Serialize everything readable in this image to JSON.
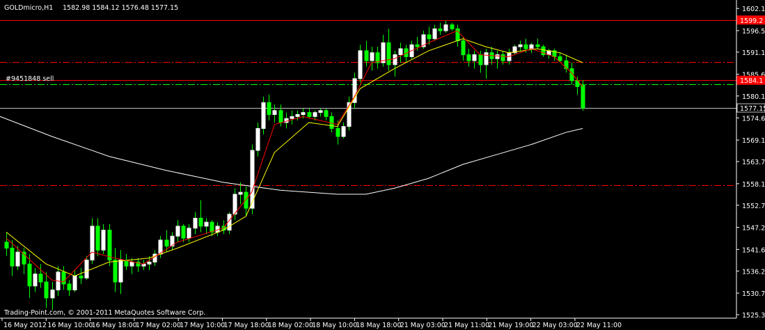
{
  "header": {
    "symbol": "GOLDmicro,H1",
    "ohlc": "1582.98 1584.12 1576.48 1577.15"
  },
  "footer": {
    "copyright": "Trading-Point.com, © 2001-2011 MetaQuotes Software Corp."
  },
  "order": {
    "label": "#9451848 sell"
  },
  "colors": {
    "background": "#000000",
    "bull_candle": "#ffffff",
    "bear_candle": "#00ff00",
    "ma_fast": "#ff0000",
    "ma_mid": "#ffff00",
    "ma_slow": "#ffffff",
    "hline_red": "#ff0000",
    "hline_green": "#00ff00",
    "price_line": "#c0c0c0",
    "tag_red": "#ff0000"
  },
  "chart_data": {
    "type": "candlestick",
    "symbol": "GOLDmicro",
    "timeframe": "H1",
    "ylim": [
      1525.3,
      1603.0
    ],
    "y_ticks": [
      "1602.10",
      "1596.55",
      "1591.15",
      "1585.60",
      "1580.15",
      "1574.65",
      "1569.10",
      "1563.70",
      "1558.15",
      "1552.75",
      "1547.20",
      "1541.65",
      "1536.25",
      "1530.70",
      "1525.30"
    ],
    "x_ticks": [
      "16 May 2012",
      "16 May 10:00",
      "16 May 18:00",
      "17 May 02:00",
      "17 May 10:00",
      "17 May 18:00",
      "18 May 02:00",
      "18 May 10:00",
      "18 May 18:00",
      "21 May 03:00",
      "21 May 11:00",
      "21 May 19:00",
      "22 May 03:00",
      "22 May 11:00"
    ],
    "price_tags": [
      {
        "price": 1599.2,
        "label": "1599.2",
        "color": "#ff0000"
      },
      {
        "price": 1584.1,
        "label": "1584.1",
        "color": "#ff0000"
      },
      {
        "price": 1577.15,
        "label": "1577.15",
        "color": "#ffffff"
      }
    ],
    "hlines": [
      {
        "price": 1599.2,
        "style": "solid",
        "color": "#ff0000"
      },
      {
        "price": 1588.6,
        "style": "dashdot",
        "color": "#ff0000"
      },
      {
        "price": 1584.1,
        "style": "solid",
        "color": "#ff0000"
      },
      {
        "price": 1583.1,
        "style": "dashdot",
        "color": "#00ff00"
      },
      {
        "price": 1577.15,
        "style": "solid",
        "color": "#c0c0c0"
      },
      {
        "price": 1557.8,
        "style": "dashdot",
        "color": "#ff0000"
      }
    ],
    "candles": [
      [
        1543.5,
        1546.0,
        1540.0,
        1542.0
      ],
      [
        1542.0,
        1544.0,
        1535.0,
        1537.5
      ],
      [
        1537.5,
        1542.5,
        1536.5,
        1541.0
      ],
      [
        1541.0,
        1542.0,
        1535.5,
        1538.0
      ],
      [
        1538.0,
        1540.5,
        1529.5,
        1532.5
      ],
      [
        1532.5,
        1537.0,
        1531.0,
        1535.5
      ],
      [
        1535.5,
        1538.0,
        1532.0,
        1533.5
      ],
      [
        1533.5,
        1536.0,
        1527.0,
        1529.5
      ],
      [
        1529.5,
        1533.5,
        1526.5,
        1531.5
      ],
      [
        1531.5,
        1537.5,
        1530.0,
        1536.0
      ],
      [
        1536.0,
        1537.5,
        1531.5,
        1533.0
      ],
      [
        1533.0,
        1534.0,
        1530.0,
        1531.5
      ],
      [
        1531.5,
        1536.5,
        1531.0,
        1535.0
      ],
      [
        1535.0,
        1537.0,
        1533.0,
        1534.5
      ],
      [
        1534.5,
        1540.0,
        1534.0,
        1539.0
      ],
      [
        1539.0,
        1549.5,
        1538.0,
        1547.5
      ],
      [
        1547.5,
        1549.5,
        1540.0,
        1541.5
      ],
      [
        1541.5,
        1548.0,
        1540.5,
        1546.5
      ],
      [
        1546.5,
        1548.0,
        1537.5,
        1539.0
      ],
      [
        1539.0,
        1542.0,
        1531.0,
        1533.5
      ],
      [
        1533.5,
        1541.5,
        1530.5,
        1539.0
      ],
      [
        1539.0,
        1540.5,
        1536.5,
        1537.5
      ],
      [
        1537.5,
        1539.5,
        1535.5,
        1538.5
      ],
      [
        1538.5,
        1539.5,
        1536.0,
        1537.5
      ],
      [
        1537.5,
        1539.0,
        1536.5,
        1538.0
      ],
      [
        1538.0,
        1540.0,
        1536.5,
        1538.5
      ],
      [
        1538.5,
        1541.5,
        1537.5,
        1540.5
      ],
      [
        1540.5,
        1545.0,
        1539.5,
        1544.0
      ],
      [
        1544.0,
        1546.5,
        1541.0,
        1542.5
      ],
      [
        1542.5,
        1546.0,
        1541.5,
        1545.0
      ],
      [
        1545.0,
        1549.0,
        1543.5,
        1547.5
      ],
      [
        1547.5,
        1548.0,
        1543.5,
        1544.5
      ],
      [
        1544.5,
        1548.0,
        1543.5,
        1547.0
      ],
      [
        1547.0,
        1551.0,
        1545.5,
        1549.5
      ],
      [
        1549.5,
        1554.0,
        1546.0,
        1547.5
      ],
      [
        1547.5,
        1549.5,
        1545.5,
        1548.5
      ],
      [
        1548.5,
        1549.0,
        1545.0,
        1546.0
      ],
      [
        1546.0,
        1548.5,
        1545.0,
        1547.5
      ],
      [
        1547.5,
        1549.0,
        1545.5,
        1546.5
      ],
      [
        1546.5,
        1551.0,
        1545.5,
        1550.5
      ],
      [
        1550.5,
        1557.0,
        1549.0,
        1555.5
      ],
      [
        1555.5,
        1558.5,
        1553.0,
        1556.0
      ],
      [
        1556.0,
        1557.5,
        1550.0,
        1552.0
      ],
      [
        1552.0,
        1568.0,
        1550.5,
        1566.5
      ],
      [
        1566.5,
        1573.5,
        1565.0,
        1572.0
      ],
      [
        1572.0,
        1580.0,
        1570.5,
        1578.5
      ],
      [
        1578.5,
        1580.5,
        1574.0,
        1575.5
      ],
      [
        1575.5,
        1578.0,
        1573.5,
        1576.5
      ],
      [
        1576.5,
        1578.0,
        1572.5,
        1573.5
      ],
      [
        1573.5,
        1576.0,
        1572.0,
        1574.5
      ],
      [
        1574.5,
        1576.5,
        1573.0,
        1575.0
      ],
      [
        1575.0,
        1576.5,
        1574.0,
        1575.5
      ],
      [
        1575.5,
        1577.0,
        1574.5,
        1576.0
      ],
      [
        1576.0,
        1577.0,
        1574.5,
        1575.0
      ],
      [
        1575.0,
        1576.5,
        1574.0,
        1576.0
      ],
      [
        1576.0,
        1577.0,
        1575.0,
        1576.5
      ],
      [
        1576.5,
        1577.0,
        1574.0,
        1575.0
      ],
      [
        1575.0,
        1576.0,
        1571.0,
        1572.0
      ],
      [
        1572.0,
        1574.0,
        1568.0,
        1570.0
      ],
      [
        1570.0,
        1573.5,
        1569.5,
        1572.5
      ],
      [
        1572.5,
        1580.0,
        1571.5,
        1578.5
      ],
      [
        1578.5,
        1586.0,
        1577.0,
        1584.5
      ],
      [
        1584.5,
        1593.0,
        1583.5,
        1591.5
      ],
      [
        1591.5,
        1594.0,
        1587.5,
        1589.0
      ],
      [
        1589.0,
        1592.5,
        1586.5,
        1591.0
      ],
      [
        1591.0,
        1592.5,
        1587.0,
        1588.5
      ],
      [
        1588.5,
        1595.5,
        1587.5,
        1593.5
      ],
      [
        1593.5,
        1597.0,
        1586.5,
        1588.0
      ],
      [
        1588.0,
        1591.5,
        1585.0,
        1590.5
      ],
      [
        1590.5,
        1593.5,
        1588.5,
        1592.0
      ],
      [
        1592.0,
        1593.0,
        1588.5,
        1590.0
      ],
      [
        1590.0,
        1594.0,
        1589.5,
        1593.0
      ],
      [
        1593.0,
        1595.0,
        1591.5,
        1592.5
      ],
      [
        1592.5,
        1596.5,
        1592.0,
        1595.5
      ],
      [
        1595.5,
        1597.5,
        1593.0,
        1594.5
      ],
      [
        1594.5,
        1598.0,
        1594.0,
        1597.0
      ],
      [
        1597.0,
        1598.5,
        1595.5,
        1596.5
      ],
      [
        1596.5,
        1599.0,
        1596.0,
        1598.0
      ],
      [
        1598.0,
        1598.5,
        1596.5,
        1597.0
      ],
      [
        1597.0,
        1598.0,
        1592.5,
        1594.0
      ],
      [
        1594.0,
        1595.0,
        1589.0,
        1590.5
      ],
      [
        1590.5,
        1592.0,
        1587.5,
        1589.0
      ],
      [
        1589.0,
        1591.5,
        1587.0,
        1590.5
      ],
      [
        1590.5,
        1591.5,
        1586.0,
        1588.0
      ],
      [
        1588.0,
        1592.0,
        1584.5,
        1591.0
      ],
      [
        1591.0,
        1592.5,
        1588.0,
        1589.5
      ],
      [
        1589.5,
        1591.5,
        1587.0,
        1590.5
      ],
      [
        1590.5,
        1591.5,
        1588.0,
        1589.0
      ],
      [
        1589.0,
        1592.0,
        1588.0,
        1591.0
      ],
      [
        1591.0,
        1593.0,
        1590.5,
        1592.5
      ],
      [
        1592.5,
        1594.0,
        1591.5,
        1593.0
      ],
      [
        1593.0,
        1594.5,
        1591.0,
        1592.0
      ],
      [
        1592.0,
        1593.5,
        1591.0,
        1593.0
      ],
      [
        1593.0,
        1594.5,
        1592.0,
        1592.5
      ],
      [
        1592.5,
        1593.0,
        1590.0,
        1590.5
      ],
      [
        1590.5,
        1592.0,
        1589.5,
        1591.5
      ],
      [
        1591.5,
        1592.0,
        1589.0,
        1590.0
      ],
      [
        1590.0,
        1591.0,
        1588.5,
        1589.0
      ],
      [
        1589.0,
        1590.5,
        1586.0,
        1587.0
      ],
      [
        1587.0,
        1588.5,
        1583.0,
        1584.0
      ],
      [
        1584.0,
        1585.0,
        1580.5,
        1582.5
      ],
      [
        1582.98,
        1584.12,
        1576.48,
        1577.15
      ]
    ],
    "ma_fast": [
      [
        0,
        1544.5
      ],
      [
        8,
        1534.0
      ],
      [
        10,
        1533.5
      ],
      [
        15,
        1541.0
      ],
      [
        19,
        1539.5
      ],
      [
        24,
        1538.0
      ],
      [
        30,
        1543.5
      ],
      [
        38,
        1547.0
      ],
      [
        43,
        1556.0
      ],
      [
        47,
        1573.0
      ],
      [
        52,
        1575.0
      ],
      [
        58,
        1573.0
      ],
      [
        61,
        1580.0
      ],
      [
        64,
        1588.5
      ],
      [
        68,
        1589.5
      ],
      [
        74,
        1593.5
      ],
      [
        79,
        1596.5
      ],
      [
        83,
        1590.5
      ],
      [
        88,
        1590.0
      ],
      [
        92,
        1592.0
      ],
      [
        96,
        1590.0
      ],
      [
        99,
        1586.0
      ],
      [
        101,
        1582.5
      ]
    ],
    "ma_mid": [
      [
        0,
        1546.0
      ],
      [
        7,
        1538.0
      ],
      [
        12,
        1535.0
      ],
      [
        18,
        1538.5
      ],
      [
        25,
        1539.5
      ],
      [
        30,
        1542.0
      ],
      [
        38,
        1546.5
      ],
      [
        42,
        1550.0
      ],
      [
        47,
        1566.0
      ],
      [
        53,
        1573.5
      ],
      [
        58,
        1572.5
      ],
      [
        62,
        1582.0
      ],
      [
        68,
        1587.0
      ],
      [
        74,
        1591.5
      ],
      [
        80,
        1594.5
      ],
      [
        84,
        1592.5
      ],
      [
        88,
        1591.0
      ],
      [
        93,
        1592.0
      ],
      [
        97,
        1591.0
      ],
      [
        101,
        1588.5
      ]
    ],
    "ma_slow": [
      [
        -2,
        1575.5
      ],
      [
        8,
        1570.0
      ],
      [
        18,
        1565.0
      ],
      [
        28,
        1561.5
      ],
      [
        38,
        1558.5
      ],
      [
        48,
        1556.5
      ],
      [
        58,
        1555.5
      ],
      [
        63,
        1555.5
      ],
      [
        68,
        1557.0
      ],
      [
        74,
        1559.5
      ],
      [
        80,
        1563.0
      ],
      [
        86,
        1565.5
      ],
      [
        92,
        1568.0
      ],
      [
        98,
        1571.0
      ],
      [
        101,
        1572.0
      ]
    ]
  }
}
